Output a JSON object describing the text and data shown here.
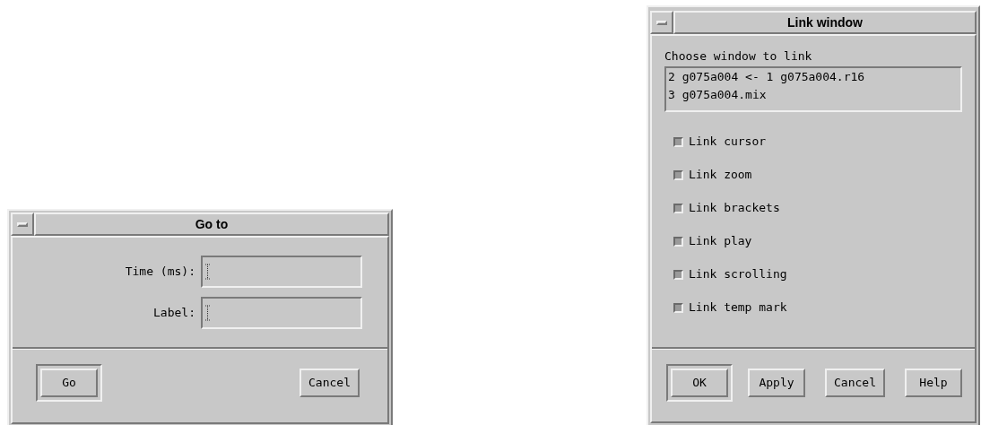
{
  "windows": [
    {
      "kind": "goto",
      "title": "Go to",
      "fields": [
        {
          "label": "Time (ms):"
        },
        {
          "label": "Label:"
        }
      ],
      "buttons": [
        {
          "label": "Go",
          "default": true
        },
        {
          "label": "Cancel",
          "default": false
        }
      ]
    },
    {
      "kind": "link",
      "title": "Link window",
      "list_label": "Choose window to link",
      "list_items": [
        "2 g075a004 <- 1 g075a004.r16",
        "3 g075a004.mix"
      ],
      "checkboxes": [
        {
          "label": "Link cursor",
          "checked": true
        },
        {
          "label": "Link zoom",
          "checked": true
        },
        {
          "label": "Link brackets",
          "checked": true
        },
        {
          "label": "Link play",
          "checked": true
        },
        {
          "label": "Link scrolling",
          "checked": true
        },
        {
          "label": "Link temp mark",
          "checked": true
        }
      ],
      "buttons": [
        {
          "label": "OK",
          "default": true
        },
        {
          "label": "Apply",
          "default": false
        },
        {
          "label": "Cancel",
          "default": false
        },
        {
          "label": "Help",
          "default": false
        }
      ]
    }
  ]
}
